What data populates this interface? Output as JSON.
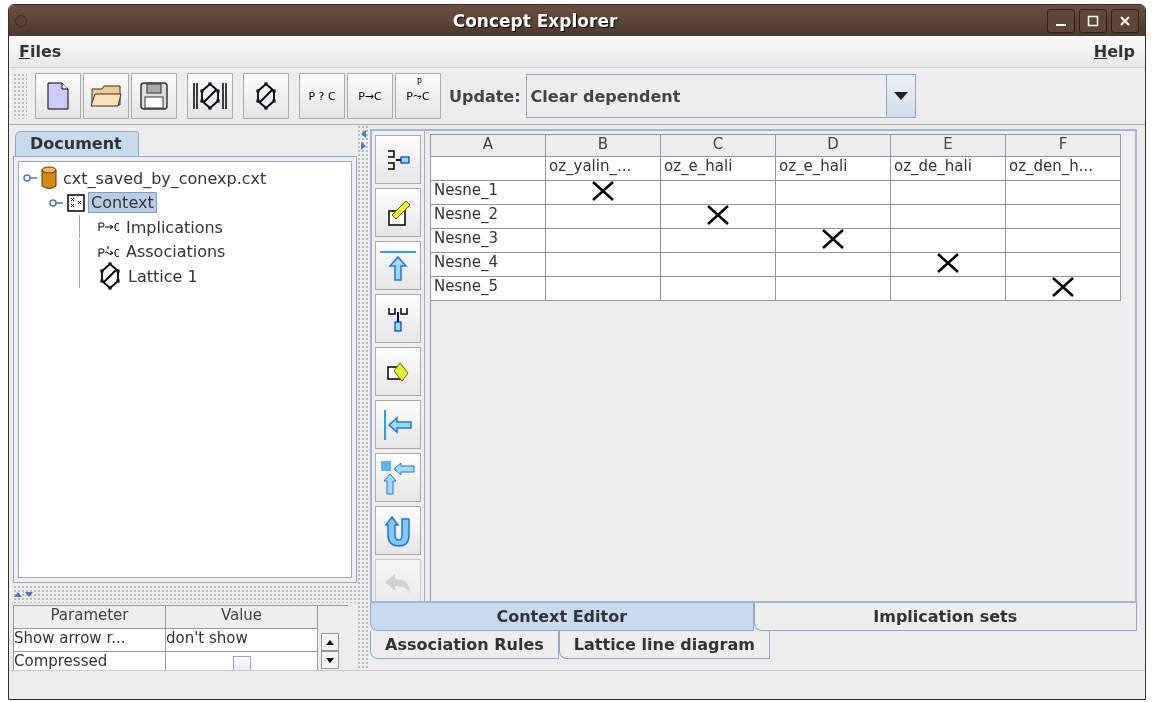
{
  "window": {
    "title": "Concept Explorer"
  },
  "menu": [
    {
      "label": "Files"
    },
    {
      "label": "Help"
    }
  ],
  "toolbar": {
    "buttons": [
      {
        "kind": "new"
      },
      {
        "kind": "open"
      },
      {
        "kind": "save"
      },
      {
        "kind": "lattice-framed"
      },
      {
        "kind": "lattice"
      },
      {
        "kind": "text",
        "label": "P ? C"
      },
      {
        "kind": "text",
        "label": "P→C"
      },
      {
        "kind": "assoc",
        "label": "P⤳C",
        "mark": "P"
      }
    ],
    "update_label": "Update:",
    "update_value": "Clear dependent"
  },
  "document_tab": {
    "label": "Document",
    "selected": true
  },
  "tree": [
    {
      "label": "cxt_saved_by_conexp.cxt",
      "kind": "cylinder",
      "expanded": true,
      "selected": false,
      "children": [
        {
          "label": "Context",
          "kind": "context",
          "expanded": true,
          "selected": true,
          "children": [
            {
              "label": "Implications",
              "kind": "implication",
              "selected": false
            },
            {
              "label": "Associations",
              "kind": "association",
              "selected": false
            },
            {
              "label": "Lattice 1",
              "kind": "lattice",
              "selected": false
            }
          ]
        }
      ]
    }
  ],
  "parameters": {
    "columns": [
      "Parameter",
      "Value"
    ],
    "rows": [
      {
        "kind": "text",
        "parameter": "Show arrow r...",
        "value": "don't show"
      },
      {
        "kind": "checkbox",
        "parameter": "Compressed",
        "checked": false
      }
    ]
  },
  "side_tools": [
    {
      "kind": "add-attr",
      "disabled": false
    },
    {
      "kind": "edit",
      "disabled": false
    },
    {
      "kind": "arrow-up",
      "disabled": false
    },
    {
      "kind": "add-obj",
      "disabled": false
    },
    {
      "kind": "edit2",
      "disabled": false
    },
    {
      "kind": "arrow-left",
      "disabled": false
    },
    {
      "kind": "arrow-corner",
      "disabled": false
    },
    {
      "kind": "u-turn",
      "disabled": false
    },
    {
      "kind": "undo",
      "disabled": true
    }
  ],
  "context_table": {
    "columns": [
      "A",
      "B",
      "C",
      "D",
      "E",
      "F"
    ],
    "attributes": [
      "oz_yalin_...",
      "oz_e_hali",
      "oz_e_hali",
      "oz_de_hali",
      "oz_den_h..."
    ],
    "rows": [
      {
        "object": "Nesne_1",
        "cells": [
          true,
          false,
          false,
          false,
          false
        ]
      },
      {
        "object": "Nesne_2",
        "cells": [
          false,
          true,
          false,
          false,
          false
        ]
      },
      {
        "object": "Nesne_3",
        "cells": [
          false,
          false,
          true,
          false,
          false
        ]
      },
      {
        "object": "Nesne_4",
        "cells": [
          false,
          false,
          false,
          true,
          false
        ]
      },
      {
        "object": "Nesne_5",
        "cells": [
          false,
          false,
          false,
          false,
          true
        ]
      }
    ]
  },
  "view_tabs": [
    [
      {
        "label": "Context Editor",
        "selected": true
      },
      {
        "label": "Implication sets",
        "selected": false
      }
    ],
    [
      {
        "label": "Association Rules",
        "selected": false
      },
      {
        "label": "Lattice line diagram",
        "selected": false
      }
    ]
  ]
}
